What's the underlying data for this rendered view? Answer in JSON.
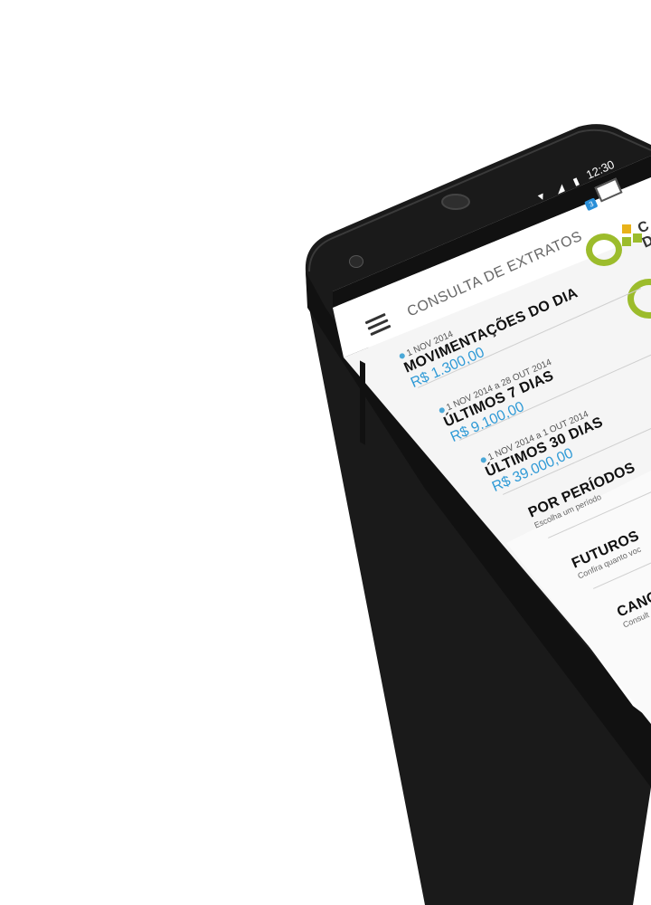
{
  "status_bar": {
    "time": "12:30"
  },
  "header": {
    "title": "CONSULTA DE EXTRATOS",
    "mail_badge": "3",
    "logo_text_1": "C",
    "logo_text_2": "D"
  },
  "items": [
    {
      "date": "1 NOV 2014",
      "title": "MOVIMENTAÇÕES DO DIA",
      "amount": "R$ 1.300,00"
    },
    {
      "date": "1 NOV 2014 a 28 OUT 2014",
      "title": "ÚLTIMOS 7 DIAS",
      "amount": "R$ 9.100,00"
    },
    {
      "date": "1 NOV 2014 a 1 OUT 2014",
      "title": "ÚLTIMOS 30 DIAS",
      "amount": "R$ 39.000,00"
    }
  ],
  "options": [
    {
      "title": "POR PERÍODOS",
      "subtitle": "Escolha um período"
    },
    {
      "title": "FUTUROS",
      "subtitle": "Confira quanto voc"
    },
    {
      "title": "CANC",
      "subtitle": "Consult"
    }
  ],
  "colors": {
    "accent_blue": "#2f9ad6",
    "ring_green": "#9cbc2c",
    "logo_yellow": "#e8b21a"
  }
}
